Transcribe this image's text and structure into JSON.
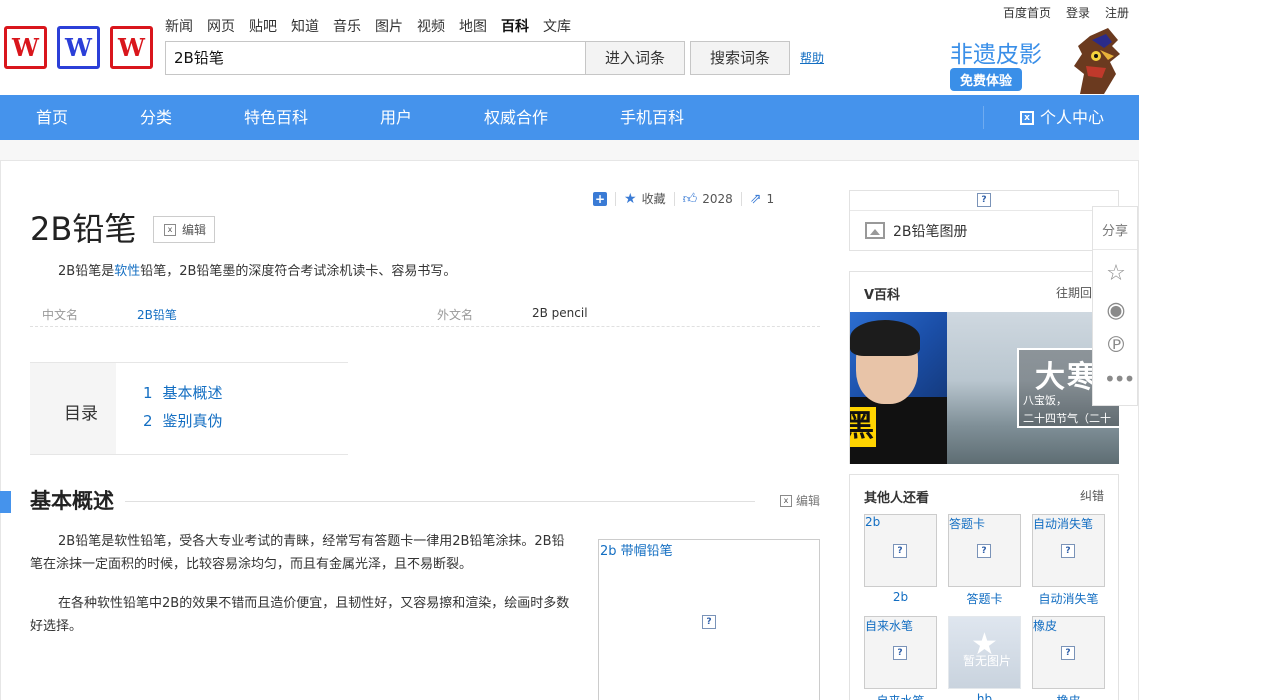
{
  "header": {
    "top_links": [
      "百度首页",
      "登录",
      "注册"
    ],
    "logo_letters": [
      "W",
      "W",
      "W"
    ],
    "channels": [
      "新闻",
      "网页",
      "贴吧",
      "知道",
      "音乐",
      "图片",
      "视频",
      "地图",
      "百科",
      "文库"
    ],
    "active_channel": "百科",
    "search_value": "2B铅笔",
    "enter_button": "进入词条",
    "search_button": "搜索词条",
    "help_link": "帮助",
    "promo_title": "非遗皮影",
    "promo_badge": "免费体验"
  },
  "main_nav": {
    "items": [
      "首页",
      "分类",
      "特色百科",
      "用户",
      "权威合作",
      "手机百科"
    ],
    "personal_center": "个人中心"
  },
  "article": {
    "tools": {
      "collect": "收藏",
      "like_count": "2028",
      "share_count": "1"
    },
    "title": "2B铅笔",
    "edit_label": "编辑",
    "summary_before": "2B铅笔是",
    "summary_link": "软性",
    "summary_after": "铅笔，2B铅笔墨的深度符合考试涂机读卡、容易书写。",
    "basic_info": [
      {
        "label": "中文名",
        "value": "2B铅笔",
        "is_link": true
      },
      {
        "label": "外文名",
        "value": "2B pencil",
        "is_link": false
      }
    ],
    "toc": {
      "title": "目录",
      "items": [
        {
          "num": "1",
          "label": "基本概述"
        },
        {
          "num": "2",
          "label": "鉴别真伪"
        }
      ]
    },
    "section": {
      "title": "基本概述",
      "edit_label": "编辑",
      "paragraphs": [
        "2B铅笔是软性铅笔，受各大专业考试的青睐，经常写有答题卡一律用2B铅笔涂抹。2B铅笔在涂抹一定面积的时候，比较容易涂均匀，而且有金属光泽，且不易断裂。",
        "在各种软性铅笔中2B的效果不错而且造价便宜，且韧性好，又容易擦和渲染，绘画时多数好选择。"
      ],
      "figure_caption": "2b 带帽铅笔"
    }
  },
  "sidebar": {
    "album_label": "2B铅笔图册",
    "vbaike": {
      "title": "V百科",
      "more": "往期回",
      "image1_caption": "黑",
      "image2_big": "大寒",
      "image2_line1": "八宝饭，",
      "image2_line2": "二十四节气（二十"
    },
    "others": {
      "title": "其他人还看",
      "report": "纠错",
      "tiles": [
        {
          "alt": "2b",
          "label": "2b"
        },
        {
          "alt": "答题卡",
          "label": "答题卡"
        },
        {
          "alt": "自动消失笔",
          "label": "自动消失笔"
        },
        {
          "alt": "自来水笔",
          "label": "自来水笔"
        },
        {
          "alt": "",
          "label": "hb",
          "no_image_text": "暂无图片"
        },
        {
          "alt": "橡皮",
          "label": "橡皮"
        }
      ]
    }
  },
  "share_bar": {
    "title": "分享",
    "icons": [
      "star-icon",
      "weibo-icon",
      "pinterest-icon",
      "more-icon"
    ]
  },
  "colors": {
    "nav_blue": "#4593ec",
    "link_blue": "#136ec2",
    "logo_red": "#d9161c",
    "logo_blue": "#2b3fd8"
  }
}
